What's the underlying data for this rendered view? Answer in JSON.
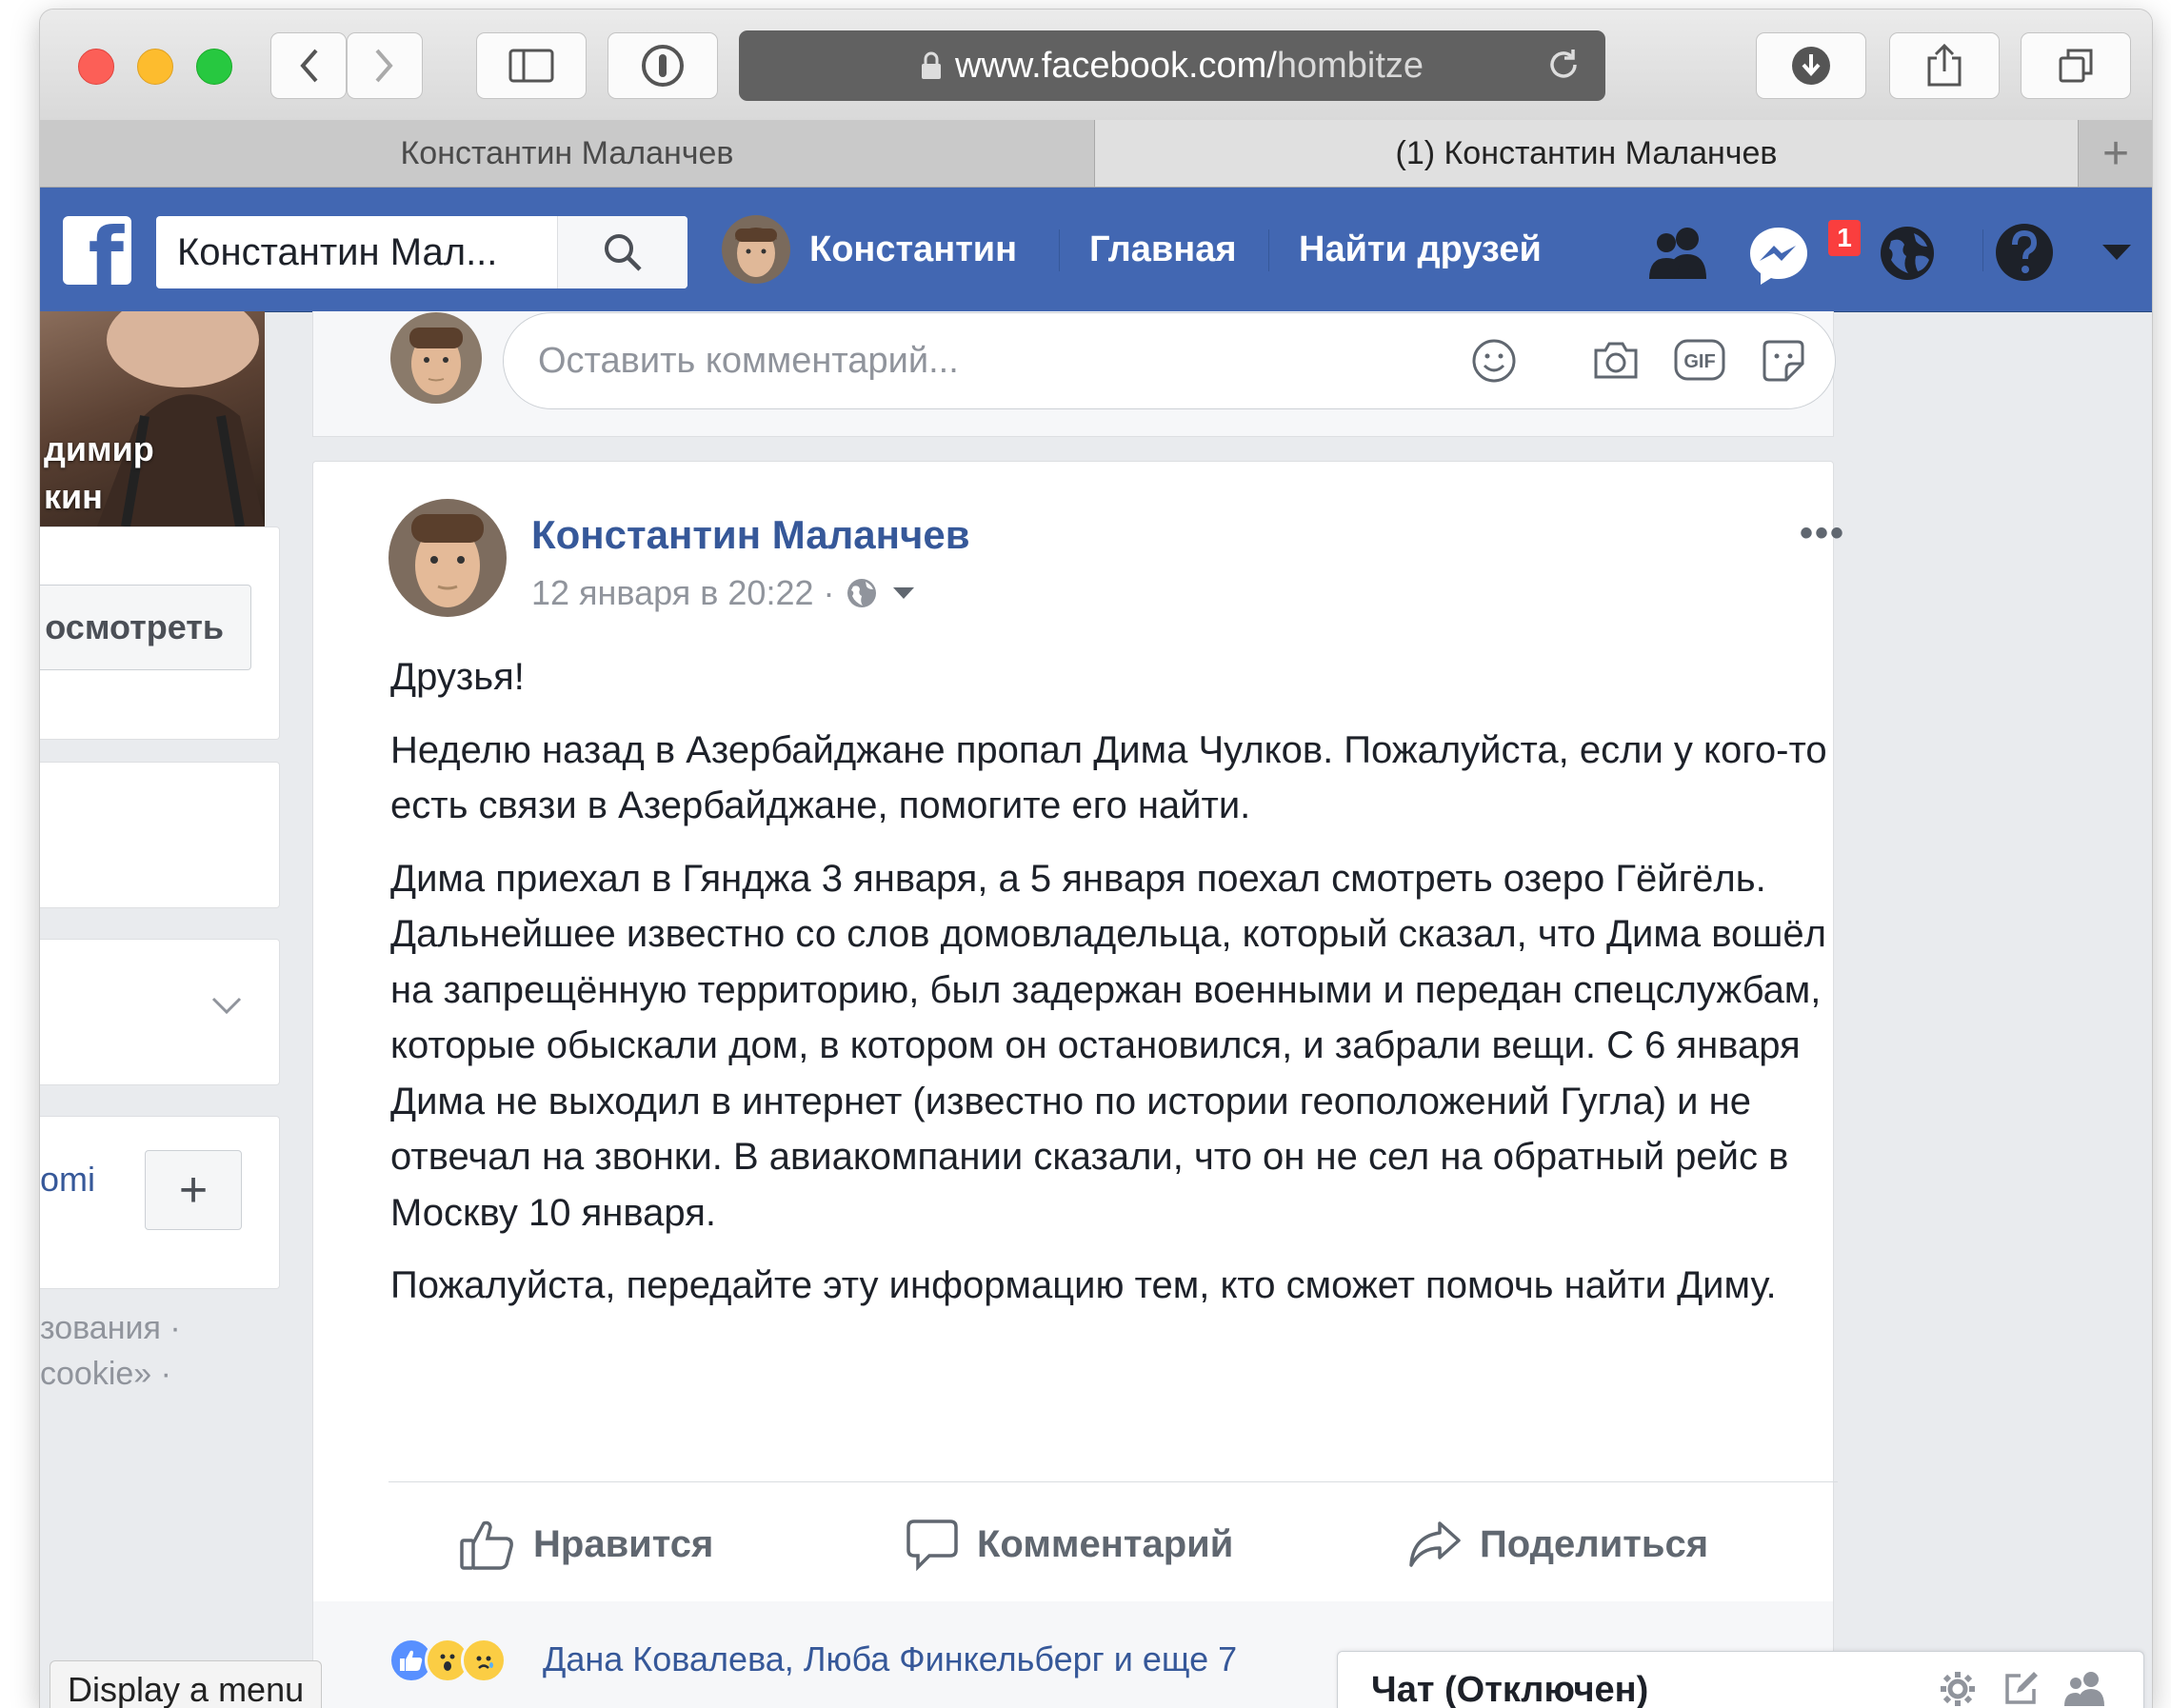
{
  "browser": {
    "url_host": "www.facebook.com/",
    "url_path": "hombitze",
    "tabs": [
      {
        "label": "Константин Маланчев"
      },
      {
        "label": "(1) Константин Маланчев"
      }
    ],
    "new_tab_label": "+"
  },
  "fb_header": {
    "logo": "f",
    "search_value": "Константин Мал...",
    "profile_label": "Константин",
    "home_label": "Главная",
    "find_friends_label": "Найти друзей",
    "messages_badge": "1",
    "brand_color": "#4267b2"
  },
  "left_column": {
    "photo_name_line1": "димир",
    "photo_name_line2": "кин",
    "view_button": "осмотреть",
    "page_link": "omi",
    "plus_button": "+",
    "footer_line1": "зования ·",
    "footer_line2": "cookie» ·"
  },
  "tooltip": "Display a menu",
  "comment_box": {
    "placeholder": "Оставить комментарий...",
    "icons": [
      "emoji-icon",
      "camera-icon",
      "gif-icon",
      "sticker-icon"
    ]
  },
  "post": {
    "author": "Константин Маланчев",
    "timestamp": "12 января в 20:22 ·",
    "more": "•••",
    "paragraphs": [
      "Друзья!",
      "Неделю назад в Азербайджане пропал Дима Чулков. Пожалуйста, если у кого-то есть связи в Азербайджане, помогите его найти.",
      "Дима приехал в Гянджа 3 января, а 5 января поехал смотреть озеро Гёйгёль. Дальнейшее известно со слов домовладельца, который сказал, что Дима вошёл на запрещённую территорию, был задержан военными и передан спецслужбам, которые обыскали дом, в котором он остановился, и забрали вещи. С 6 января Дима не выходил в интернет (известно по истории геоположений Гугла) и не отвечал на звонки. В авиакомпании сказали, что он не сел на обратный рейс в Москву 10 января.",
      "Пожалуйста, передайте эту информацию тем, кто сможет помочь найти Диму."
    ],
    "actions": {
      "like": "Нравится",
      "comment": "Комментарий",
      "share": "Поделиться"
    },
    "reactions_text": "Дана Ковалева, Люба Финкельберг и еще 7"
  },
  "chat": {
    "label": "Чат (Отключен)"
  }
}
